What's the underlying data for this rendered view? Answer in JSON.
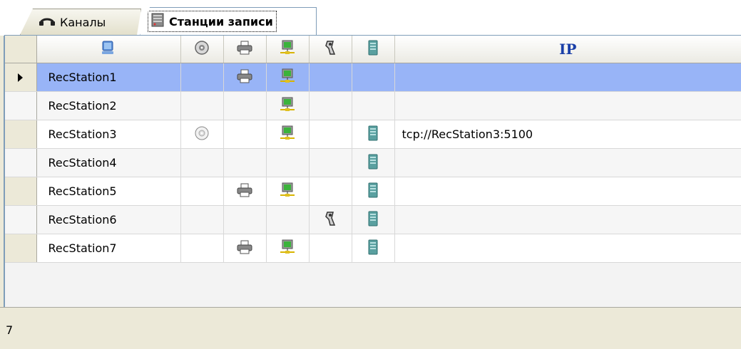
{
  "tabs": [
    {
      "label": "Каналы",
      "icon": "headset-icon",
      "active": false
    },
    {
      "label": "Станции записи",
      "icon": "recording-station-icon",
      "active": true
    }
  ],
  "columns": {
    "name_icon": "computer-icon",
    "cd_icon": "cd-disc-icon",
    "printer_icon": "printer-icon",
    "network_icon": "network-computer-icon",
    "tape_icon": "tape-icon",
    "server_icon": "server-icon",
    "ip_label": "IP"
  },
  "rows": [
    {
      "name": "RecStation1",
      "cd": false,
      "printer": true,
      "network": true,
      "tape": false,
      "server": false,
      "ip": "",
      "selected": true
    },
    {
      "name": "RecStation2",
      "cd": false,
      "printer": false,
      "network": true,
      "tape": false,
      "server": false,
      "ip": ""
    },
    {
      "name": "RecStation3",
      "cd": true,
      "printer": false,
      "network": true,
      "tape": false,
      "server": true,
      "ip": "tcp://RecStation3:5100"
    },
    {
      "name": "RecStation4",
      "cd": false,
      "printer": false,
      "network": false,
      "tape": false,
      "server": true,
      "ip": ""
    },
    {
      "name": "RecStation5",
      "cd": false,
      "printer": true,
      "network": true,
      "tape": false,
      "server": true,
      "ip": ""
    },
    {
      "name": "RecStation6",
      "cd": false,
      "printer": false,
      "network": false,
      "tape": true,
      "server": true,
      "ip": ""
    },
    {
      "name": "RecStation7",
      "cd": false,
      "printer": true,
      "network": true,
      "tape": false,
      "server": true,
      "ip": ""
    }
  ],
  "footer": {
    "count": "7"
  },
  "colors": {
    "selection": "#98b4f7",
    "ip_header": "#1a3fa8"
  }
}
